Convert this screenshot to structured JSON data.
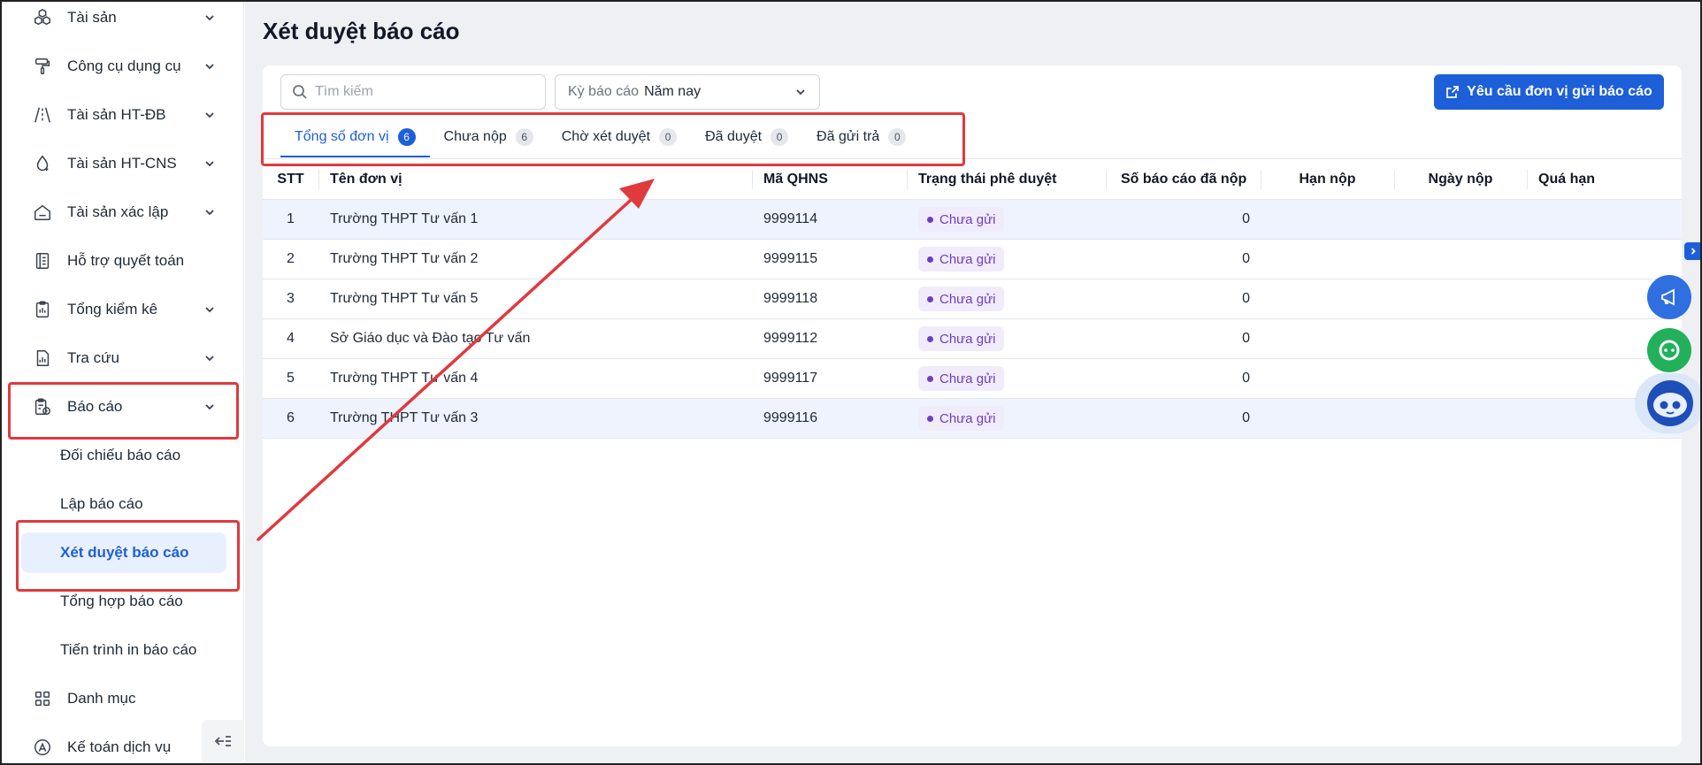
{
  "sidebar": {
    "items": [
      {
        "label": "Tài sản",
        "icon": "cubes-icon",
        "chevron": true
      },
      {
        "label": "Công cụ dụng cụ",
        "icon": "paint-roller-icon",
        "chevron": true
      },
      {
        "label": "Tài sản HT-ĐB",
        "icon": "road-icon",
        "chevron": true
      },
      {
        "label": "Tài sản HT-CNS",
        "icon": "water-drop-icon",
        "chevron": true
      },
      {
        "label": "Tài sản xác lập",
        "icon": "house-icon",
        "chevron": true
      },
      {
        "label": "Hỗ trợ quyết toán",
        "icon": "ledger-icon",
        "chevron": false
      },
      {
        "label": "Tổng kiểm kê",
        "icon": "clipboard-icon",
        "chevron": true
      },
      {
        "label": "Tra cứu",
        "icon": "chart-doc-icon",
        "chevron": true
      },
      {
        "label": "Báo cáo",
        "icon": "report-icon",
        "chevron": true
      },
      {
        "label": "Danh mục",
        "icon": "grid-icon",
        "chevron": false
      },
      {
        "label": "Kế toán dịch vụ",
        "icon": "accounting-icon",
        "chevron": false
      }
    ],
    "report_subitems": [
      {
        "label": "Đối chiếu báo cáo"
      },
      {
        "label": "Lập báo cáo"
      },
      {
        "label": "Xét duyệt báo cáo"
      },
      {
        "label": "Tổng hợp báo cáo"
      },
      {
        "label": "Tiến trình in báo cáo"
      }
    ]
  },
  "main": {
    "title": "Xét duyệt báo cáo",
    "search_placeholder": "Tìm kiếm",
    "period_label": "Kỳ báo cáo",
    "period_value": "Năm nay",
    "request_button": "Yêu cầu đơn vị gửi báo cáo",
    "tabs": [
      {
        "label": "Tổng số đơn vị",
        "count": "6"
      },
      {
        "label": "Chưa nộp",
        "count": "6"
      },
      {
        "label": "Chờ xét duyệt",
        "count": "0"
      },
      {
        "label": "Đã duyệt",
        "count": "0"
      },
      {
        "label": "Đã gửi trả",
        "count": "0"
      }
    ],
    "columns": [
      "STT",
      "Tên đơn vị",
      "Mã QHNS",
      "Trạng thái phê duyệt",
      "Số báo cáo đã nộp",
      "Hạn nộp",
      "Ngày nộp",
      "Quá hạn"
    ],
    "rows": [
      {
        "stt": "1",
        "name": "Trường THPT Tư vấn 1",
        "code": "9999114",
        "status": "Chưa gửi",
        "submitted": "0",
        "deadline": "",
        "date": "",
        "overdue": ""
      },
      {
        "stt": "2",
        "name": "Trường THPT Tư vấn 2",
        "code": "9999115",
        "status": "Chưa gửi",
        "submitted": "0",
        "deadline": "",
        "date": "",
        "overdue": ""
      },
      {
        "stt": "3",
        "name": "Trường THPT Tư vấn 5",
        "code": "9999118",
        "status": "Chưa gửi",
        "submitted": "0",
        "deadline": "",
        "date": "",
        "overdue": ""
      },
      {
        "stt": "4",
        "name": "Sở Giáo dục và Đào tạo Tư vấn",
        "code": "9999112",
        "status": "Chưa gửi",
        "submitted": "0",
        "deadline": "",
        "date": "",
        "overdue": ""
      },
      {
        "stt": "5",
        "name": "Trường THPT Tư vấn 4",
        "code": "9999117",
        "status": "Chưa gửi",
        "submitted": "0",
        "deadline": "",
        "date": "",
        "overdue": ""
      },
      {
        "stt": "6",
        "name": "Trường THPT Tư vấn 3",
        "code": "9999116",
        "status": "Chưa gửi",
        "submitted": "0",
        "deadline": "",
        "date": "",
        "overdue": ""
      }
    ]
  },
  "colors": {
    "accent": "#1d5fd8",
    "annotation": "#e0393e",
    "status_text": "#6d3fc0",
    "status_bg": "#f1ecfb"
  }
}
